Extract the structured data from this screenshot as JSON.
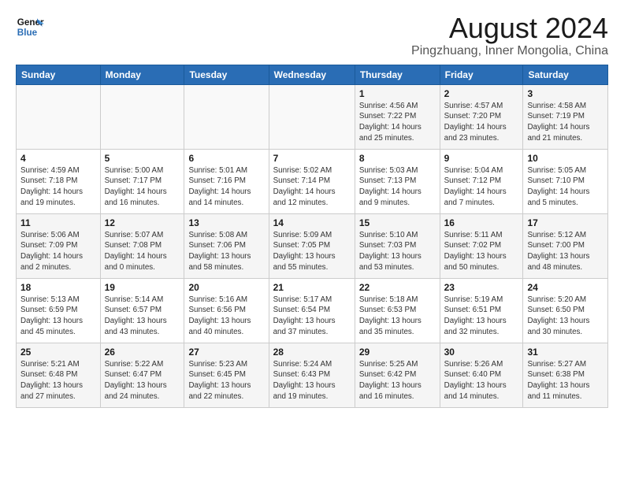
{
  "header": {
    "logo_line1": "General",
    "logo_line2": "Blue",
    "title": "August 2024",
    "subtitle": "Pingzhuang, Inner Mongolia, China"
  },
  "weekdays": [
    "Sunday",
    "Monday",
    "Tuesday",
    "Wednesday",
    "Thursday",
    "Friday",
    "Saturday"
  ],
  "weeks": [
    [
      {
        "day": "",
        "info": ""
      },
      {
        "day": "",
        "info": ""
      },
      {
        "day": "",
        "info": ""
      },
      {
        "day": "",
        "info": ""
      },
      {
        "day": "1",
        "info": "Sunrise: 4:56 AM\nSunset: 7:22 PM\nDaylight: 14 hours\nand 25 minutes."
      },
      {
        "day": "2",
        "info": "Sunrise: 4:57 AM\nSunset: 7:20 PM\nDaylight: 14 hours\nand 23 minutes."
      },
      {
        "day": "3",
        "info": "Sunrise: 4:58 AM\nSunset: 7:19 PM\nDaylight: 14 hours\nand 21 minutes."
      }
    ],
    [
      {
        "day": "4",
        "info": "Sunrise: 4:59 AM\nSunset: 7:18 PM\nDaylight: 14 hours\nand 19 minutes."
      },
      {
        "day": "5",
        "info": "Sunrise: 5:00 AM\nSunset: 7:17 PM\nDaylight: 14 hours\nand 16 minutes."
      },
      {
        "day": "6",
        "info": "Sunrise: 5:01 AM\nSunset: 7:16 PM\nDaylight: 14 hours\nand 14 minutes."
      },
      {
        "day": "7",
        "info": "Sunrise: 5:02 AM\nSunset: 7:14 PM\nDaylight: 14 hours\nand 12 minutes."
      },
      {
        "day": "8",
        "info": "Sunrise: 5:03 AM\nSunset: 7:13 PM\nDaylight: 14 hours\nand 9 minutes."
      },
      {
        "day": "9",
        "info": "Sunrise: 5:04 AM\nSunset: 7:12 PM\nDaylight: 14 hours\nand 7 minutes."
      },
      {
        "day": "10",
        "info": "Sunrise: 5:05 AM\nSunset: 7:10 PM\nDaylight: 14 hours\nand 5 minutes."
      }
    ],
    [
      {
        "day": "11",
        "info": "Sunrise: 5:06 AM\nSunset: 7:09 PM\nDaylight: 14 hours\nand 2 minutes."
      },
      {
        "day": "12",
        "info": "Sunrise: 5:07 AM\nSunset: 7:08 PM\nDaylight: 14 hours\nand 0 minutes."
      },
      {
        "day": "13",
        "info": "Sunrise: 5:08 AM\nSunset: 7:06 PM\nDaylight: 13 hours\nand 58 minutes."
      },
      {
        "day": "14",
        "info": "Sunrise: 5:09 AM\nSunset: 7:05 PM\nDaylight: 13 hours\nand 55 minutes."
      },
      {
        "day": "15",
        "info": "Sunrise: 5:10 AM\nSunset: 7:03 PM\nDaylight: 13 hours\nand 53 minutes."
      },
      {
        "day": "16",
        "info": "Sunrise: 5:11 AM\nSunset: 7:02 PM\nDaylight: 13 hours\nand 50 minutes."
      },
      {
        "day": "17",
        "info": "Sunrise: 5:12 AM\nSunset: 7:00 PM\nDaylight: 13 hours\nand 48 minutes."
      }
    ],
    [
      {
        "day": "18",
        "info": "Sunrise: 5:13 AM\nSunset: 6:59 PM\nDaylight: 13 hours\nand 45 minutes."
      },
      {
        "day": "19",
        "info": "Sunrise: 5:14 AM\nSunset: 6:57 PM\nDaylight: 13 hours\nand 43 minutes."
      },
      {
        "day": "20",
        "info": "Sunrise: 5:16 AM\nSunset: 6:56 PM\nDaylight: 13 hours\nand 40 minutes."
      },
      {
        "day": "21",
        "info": "Sunrise: 5:17 AM\nSunset: 6:54 PM\nDaylight: 13 hours\nand 37 minutes."
      },
      {
        "day": "22",
        "info": "Sunrise: 5:18 AM\nSunset: 6:53 PM\nDaylight: 13 hours\nand 35 minutes."
      },
      {
        "day": "23",
        "info": "Sunrise: 5:19 AM\nSunset: 6:51 PM\nDaylight: 13 hours\nand 32 minutes."
      },
      {
        "day": "24",
        "info": "Sunrise: 5:20 AM\nSunset: 6:50 PM\nDaylight: 13 hours\nand 30 minutes."
      }
    ],
    [
      {
        "day": "25",
        "info": "Sunrise: 5:21 AM\nSunset: 6:48 PM\nDaylight: 13 hours\nand 27 minutes."
      },
      {
        "day": "26",
        "info": "Sunrise: 5:22 AM\nSunset: 6:47 PM\nDaylight: 13 hours\nand 24 minutes."
      },
      {
        "day": "27",
        "info": "Sunrise: 5:23 AM\nSunset: 6:45 PM\nDaylight: 13 hours\nand 22 minutes."
      },
      {
        "day": "28",
        "info": "Sunrise: 5:24 AM\nSunset: 6:43 PM\nDaylight: 13 hours\nand 19 minutes."
      },
      {
        "day": "29",
        "info": "Sunrise: 5:25 AM\nSunset: 6:42 PM\nDaylight: 13 hours\nand 16 minutes."
      },
      {
        "day": "30",
        "info": "Sunrise: 5:26 AM\nSunset: 6:40 PM\nDaylight: 13 hours\nand 14 minutes."
      },
      {
        "day": "31",
        "info": "Sunrise: 5:27 AM\nSunset: 6:38 PM\nDaylight: 13 hours\nand 11 minutes."
      }
    ]
  ]
}
